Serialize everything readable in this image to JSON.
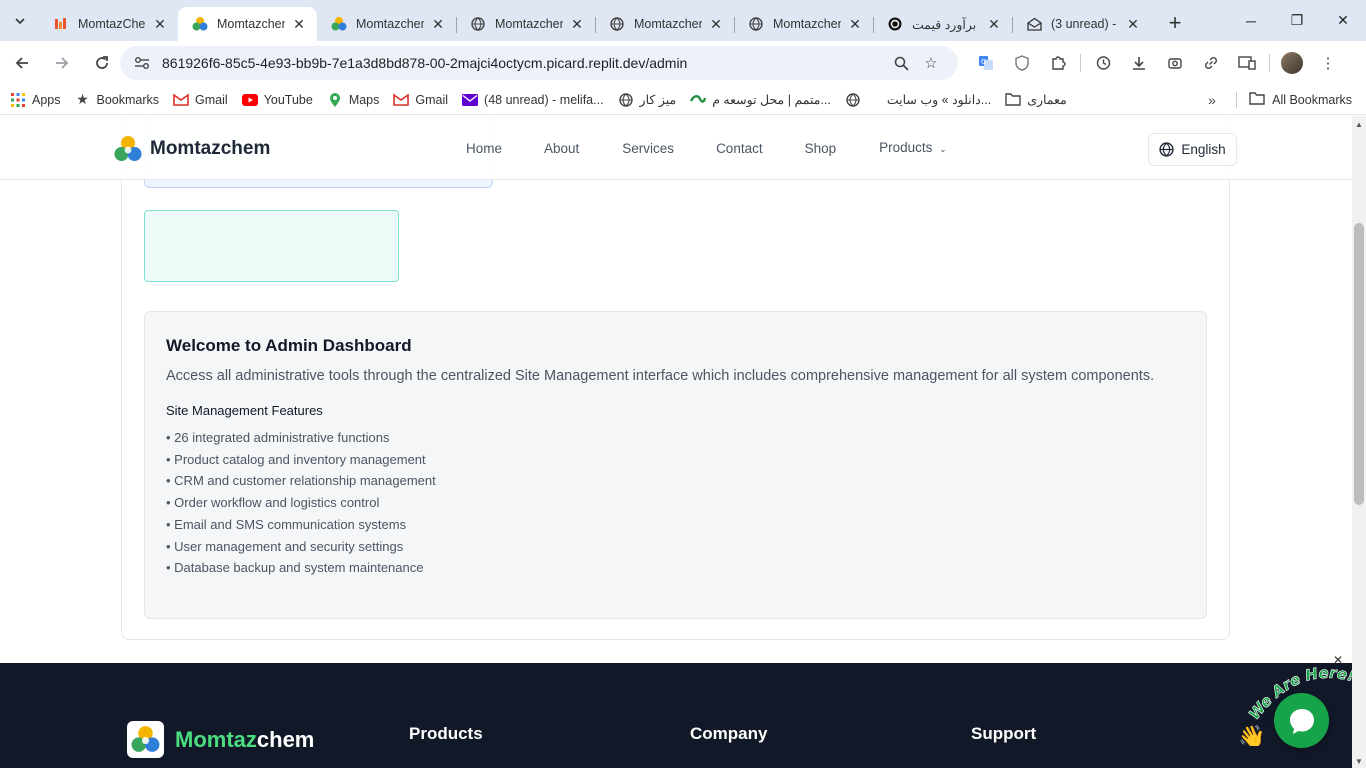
{
  "browser": {
    "tabs": [
      {
        "title": "MomtazChem",
        "active": false
      },
      {
        "title": "Momtazchem",
        "active": true
      },
      {
        "title": "Momtazchem",
        "active": false
      },
      {
        "title": "Momtazchem",
        "active": false
      },
      {
        "title": "Momtazchem",
        "active": false
      },
      {
        "title": "Momtazchem",
        "active": false
      },
      {
        "title": "برآورد قیمت",
        "active": false
      },
      {
        "title": "(3 unread) -",
        "active": false
      }
    ],
    "url": "861926f6-85c5-4e93-bb9b-7e1a3d8bd878-00-2majci4octycm.picard.replit.dev/admin",
    "bookmarks": [
      {
        "label": "Apps",
        "icon": "apps-grid-icon"
      },
      {
        "label": "Bookmarks",
        "icon": "star-icon"
      },
      {
        "label": "Gmail",
        "icon": "gmail-icon"
      },
      {
        "label": "YouTube",
        "icon": "youtube-icon"
      },
      {
        "label": "Maps",
        "icon": "maps-icon"
      },
      {
        "label": "Gmail",
        "icon": "gmail-icon"
      },
      {
        "label": "(48 unread) - melifa...",
        "icon": "yahoo-mail-icon"
      },
      {
        "label": "میز کار",
        "icon": "globe-icon"
      },
      {
        "label": "متمم | محل توسعه م...",
        "icon": "motamem-icon"
      },
      {
        "label": "دانلود » وب سایت...",
        "icon": "globe-icon"
      },
      {
        "label": "معماری",
        "icon": "folder-icon"
      }
    ],
    "all_bookmarks": "All Bookmarks"
  },
  "site": {
    "logo": "Momtazchem",
    "nav": [
      "Home",
      "About",
      "Services",
      "Contact",
      "Shop"
    ],
    "products_label": "Products",
    "language": "English"
  },
  "welcome": {
    "title": "Welcome to Admin Dashboard",
    "description": "Access all administrative tools through the centralized Site Management interface which includes comprehensive management for all system components.",
    "features_title": "Site Management Features",
    "features": [
      "• 26 integrated administrative functions",
      "• Product catalog and inventory management",
      "• CRM and customer relationship management",
      "• Order workflow and logistics control",
      "• Email and SMS communication systems",
      "• User management and security settings",
      "• Database backup and system maintenance"
    ]
  },
  "footer": {
    "brand_a": "Momtaz",
    "brand_b": "chem",
    "columns": [
      "Products",
      "Company",
      "Support"
    ]
  },
  "chat": {
    "badge_text": "We Are Here!"
  },
  "colors": {
    "footer_bg": "#111827",
    "brand_green": "#4ade80",
    "chat_green": "#16a34a"
  }
}
